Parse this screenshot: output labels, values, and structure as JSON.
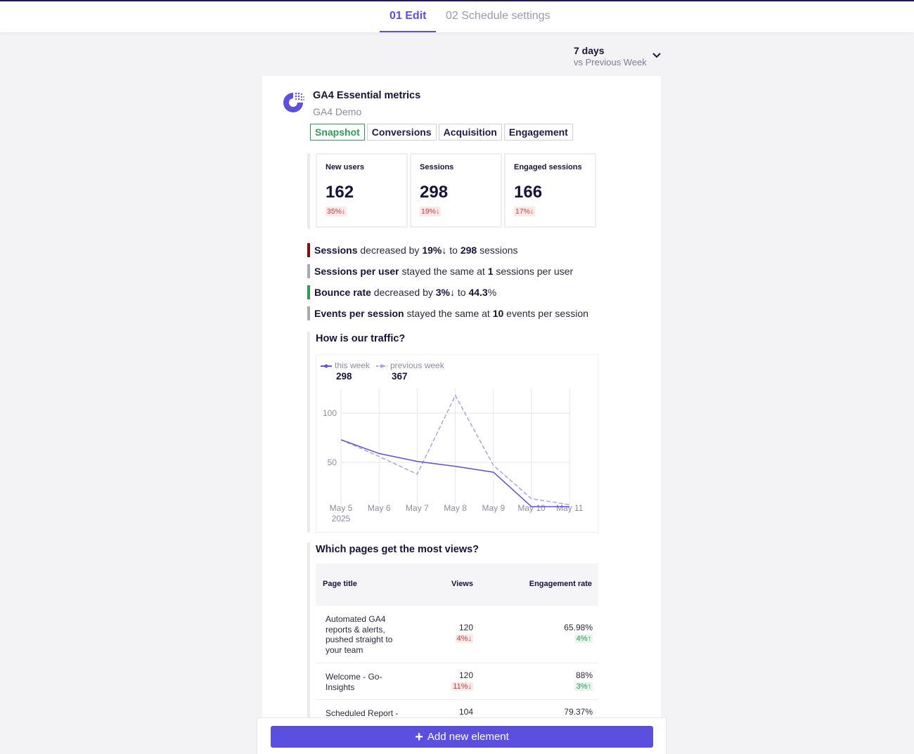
{
  "tabs": [
    {
      "label": "01 Edit"
    },
    {
      "label": "02 Schedule settings"
    }
  ],
  "period": {
    "days": "7 days",
    "comparison": "vs Previous Week"
  },
  "report": {
    "title": "GA4 Essential metrics",
    "subtitle": "GA4 Demo",
    "tabs": [
      "Snapshot",
      "Conversions",
      "Acquisition",
      "Engagement"
    ]
  },
  "kpis": [
    {
      "label": "New users",
      "value": "162",
      "delta": "35%↓"
    },
    {
      "label": "Sessions",
      "value": "298",
      "delta": "19%↓"
    },
    {
      "label": "Engaged sessions",
      "value": "166",
      "delta": "17%↓"
    }
  ],
  "insights": [
    {
      "color": "#8b0a0a",
      "parts": [
        [
          "b",
          "Sessions"
        ],
        [
          "t",
          " decreased by "
        ],
        [
          "b",
          "19%↓"
        ],
        [
          "t",
          " to "
        ],
        [
          "b",
          "298"
        ],
        [
          "t",
          " sessions"
        ]
      ]
    },
    {
      "color": "#a9a9b3",
      "parts": [
        [
          "b",
          "Sessions per user"
        ],
        [
          "t",
          " stayed the same at "
        ],
        [
          "b",
          "1"
        ],
        [
          "t",
          " sessions per user"
        ]
      ]
    },
    {
      "color": "#2e9c57",
      "parts": [
        [
          "b",
          "Bounce rate"
        ],
        [
          "t",
          " decreased by "
        ],
        [
          "b",
          "3%↓"
        ],
        [
          "t",
          " to "
        ],
        [
          "b",
          "44.3"
        ],
        [
          "t",
          "%"
        ]
      ]
    },
    {
      "color": "#a9a9b3",
      "parts": [
        [
          "b",
          "Events per session"
        ],
        [
          "t",
          " stayed the same at "
        ],
        [
          "b",
          "10"
        ],
        [
          "t",
          " events per session"
        ]
      ]
    }
  ],
  "traffic": {
    "title": "How is our traffic?",
    "legend": [
      {
        "name": "this week",
        "value": "298"
      },
      {
        "name": "previous week",
        "value": "367"
      }
    ]
  },
  "chart_data": {
    "type": "line",
    "x": [
      "May 5",
      "May 6",
      "May 7",
      "May 8",
      "May 9",
      "May 10",
      "May 11"
    ],
    "x_sublabel": "2025",
    "series": [
      {
        "name": "this week",
        "color": "#5b4fe0",
        "dashed": false,
        "values": [
          73,
          59,
          51,
          46,
          40,
          5,
          5
        ]
      },
      {
        "name": "previous week",
        "color": "#a9a2ec",
        "dashed": true,
        "values": [
          73,
          56,
          38,
          118,
          47,
          13,
          7
        ]
      }
    ],
    "yticks": [
      50,
      100
    ],
    "ylim": [
      0,
      125
    ],
    "grid": true
  },
  "pages": {
    "title": "Which pages get the most views?",
    "columns": [
      "Page title",
      "Views",
      "Engagement rate"
    ],
    "rows": [
      {
        "title": "Automated GA4 reports & alerts, pushed straight to your team",
        "views": "120",
        "views_delta": "4%↓",
        "views_dir": "down",
        "eng": "65.98%",
        "eng_delta": "4%↑",
        "eng_dir": "up"
      },
      {
        "title": "Welcome - Go-Insights",
        "views": "120",
        "views_delta": "11%↓",
        "views_dir": "down",
        "eng": "88%",
        "eng_delta": "3%↑",
        "eng_dir": "up"
      },
      {
        "title": "Scheduled Report -",
        "views": "104",
        "views_delta": "",
        "views_dir": "",
        "eng": "79.37%",
        "eng_delta": "",
        "eng_dir": ""
      }
    ]
  },
  "add_button": {
    "label": "Add new element"
  }
}
